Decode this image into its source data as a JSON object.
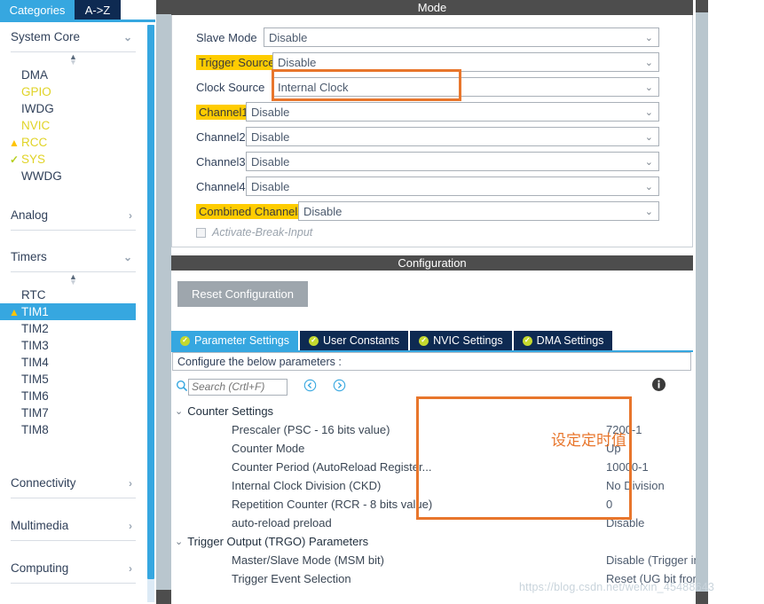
{
  "sidebar": {
    "tabs": [
      {
        "label": "Categories",
        "active": true
      },
      {
        "label": "A->Z",
        "active": false
      }
    ],
    "sections": [
      {
        "label": "System Core",
        "expanded": true,
        "chevron": "chevron-down",
        "items": [
          {
            "label": "DMA",
            "state": "normal",
            "badge": ""
          },
          {
            "label": "GPIO",
            "state": "configured",
            "badge": ""
          },
          {
            "label": "IWDG",
            "state": "normal",
            "badge": ""
          },
          {
            "label": "NVIC",
            "state": "configured",
            "badge": ""
          },
          {
            "label": "RCC",
            "state": "warning",
            "badge": "warning-triangle"
          },
          {
            "label": "SYS",
            "state": "configured",
            "badge": "check-mark"
          },
          {
            "label": "WWDG",
            "state": "normal",
            "badge": ""
          }
        ]
      },
      {
        "label": "Analog",
        "expanded": false,
        "chevron": "chevron-right",
        "items": []
      },
      {
        "label": "Timers",
        "expanded": true,
        "chevron": "chevron-down",
        "items": [
          {
            "label": "RTC",
            "state": "normal",
            "badge": ""
          },
          {
            "label": "TIM1",
            "state": "selected-warning",
            "badge": "warning-triangle"
          },
          {
            "label": "TIM2",
            "state": "normal",
            "badge": ""
          },
          {
            "label": "TIM3",
            "state": "normal",
            "badge": ""
          },
          {
            "label": "TIM4",
            "state": "normal",
            "badge": ""
          },
          {
            "label": "TIM5",
            "state": "normal",
            "badge": ""
          },
          {
            "label": "TIM6",
            "state": "normal",
            "badge": ""
          },
          {
            "label": "TIM7",
            "state": "normal",
            "badge": ""
          },
          {
            "label": "TIM8",
            "state": "normal",
            "badge": ""
          }
        ]
      },
      {
        "label": "Connectivity",
        "expanded": false,
        "chevron": "chevron-right",
        "items": []
      },
      {
        "label": "Multimedia",
        "expanded": false,
        "chevron": "chevron-right",
        "items": []
      },
      {
        "label": "Computing",
        "expanded": false,
        "chevron": "chevron-right",
        "items": []
      }
    ]
  },
  "mode": {
    "title": "Mode",
    "rows": [
      {
        "label": "Slave Mode",
        "value": "Disable",
        "highlight": false
      },
      {
        "label": "Trigger Source",
        "value": "Disable",
        "highlight": true
      },
      {
        "label": "Clock Source",
        "value": "Internal Clock",
        "highlight": false
      },
      {
        "label": "Channel1",
        "value": "Disable",
        "highlight": true
      },
      {
        "label": "Channel2",
        "value": "Disable",
        "highlight": false
      },
      {
        "label": "Channel3",
        "value": "Disable",
        "highlight": false
      },
      {
        "label": "Channel4",
        "value": "Disable",
        "highlight": false
      },
      {
        "label": "Combined Channels",
        "value": "Disable",
        "highlight": true
      }
    ],
    "checkbox": {
      "label": "Activate-Break-Input",
      "checked": false
    }
  },
  "configuration": {
    "title": "Configuration",
    "reset_button": "Reset Configuration",
    "tabs": [
      {
        "label": "Parameter Settings",
        "active": true
      },
      {
        "label": "User Constants",
        "active": false
      },
      {
        "label": "NVIC Settings",
        "active": false
      },
      {
        "label": "DMA Settings",
        "active": false
      }
    ],
    "hint": "Configure the below parameters :",
    "search": {
      "placeholder": "Search (Crtl+F)",
      "value": ""
    },
    "groups": [
      {
        "label": "Counter Settings",
        "expanded": true,
        "params": [
          {
            "name": "Prescaler (PSC - 16 bits value)",
            "value": "7200-1"
          },
          {
            "name": "Counter Mode",
            "value": "Up"
          },
          {
            "name": "Counter Period (AutoReload Register...",
            "value": "10000-1"
          },
          {
            "name": "Internal Clock Division (CKD)",
            "value": "No Division"
          },
          {
            "name": "Repetition Counter (RCR - 8 bits value)",
            "value": "0"
          },
          {
            "name": "auto-reload preload",
            "value": "Disable"
          }
        ]
      },
      {
        "label": "Trigger Output (TRGO) Parameters",
        "expanded": true,
        "params": [
          {
            "name": "Master/Slave Mode (MSM bit)",
            "value": "Disable (Trigger input effect not delayed)"
          },
          {
            "name": "Trigger Event Selection",
            "value": "Reset (UG bit from TIMx_EGR)"
          }
        ]
      }
    ]
  },
  "annotations": {
    "clock_source_box": "",
    "counter_box": "",
    "counter_note": "设定定时值"
  },
  "watermark": "https://blog.csdn.net/weixin_45488643",
  "colors": {
    "accent_blue": "#36a7e0",
    "dark_navy": "#0e2a52",
    "panel_header": "#4d4d4d",
    "highlight_yellow": "#ffcc00",
    "annotation_orange": "#e8762c",
    "warning_yellow": "#ffc400",
    "check_green": "#b6cf1d",
    "configured_yellow": "#e0d326"
  }
}
